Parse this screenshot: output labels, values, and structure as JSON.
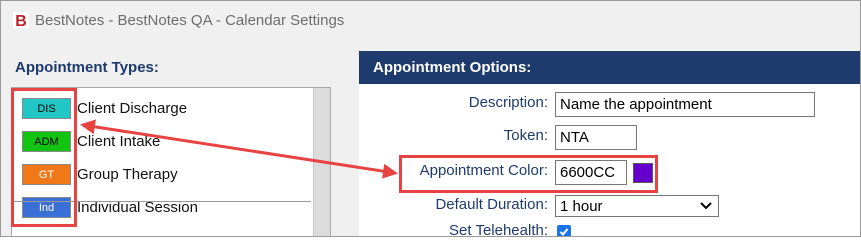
{
  "window": {
    "title": "BestNotes - BestNotes QA - Calendar Settings",
    "logo_letter": "B"
  },
  "appointment_types": {
    "heading": "Appointment Types:",
    "items": [
      {
        "code": "DIS",
        "label": "Client Discharge",
        "badge_color": "#21c7c7",
        "text_color": "#000000"
      },
      {
        "code": "ADM",
        "label": "Client Intake",
        "badge_color": "#12c312",
        "text_color": "#000000"
      },
      {
        "code": "GT",
        "label": "Group Therapy",
        "badge_color": "#f07818",
        "text_color": "#ffffff"
      },
      {
        "code": "Ind",
        "label": "Individual Session",
        "badge_color": "#3a6fd8",
        "text_color": "#ffffff"
      }
    ]
  },
  "appointment_options": {
    "heading": "Appointment Options:",
    "description_label": "Description:",
    "description_value": "Name the appointment",
    "token_label": "Token:",
    "token_value": "NTA",
    "color_label": "Appointment Color:",
    "color_value": "6600CC",
    "color_swatch": "#6600cc",
    "duration_label": "Default Duration:",
    "duration_value": "1 hour",
    "telehealth_label": "Set Telehealth:",
    "telehealth_checked": true
  },
  "colors": {
    "header_bg": "#1f3b6e",
    "annotation": "#e84343",
    "logo": "#c0392b"
  }
}
